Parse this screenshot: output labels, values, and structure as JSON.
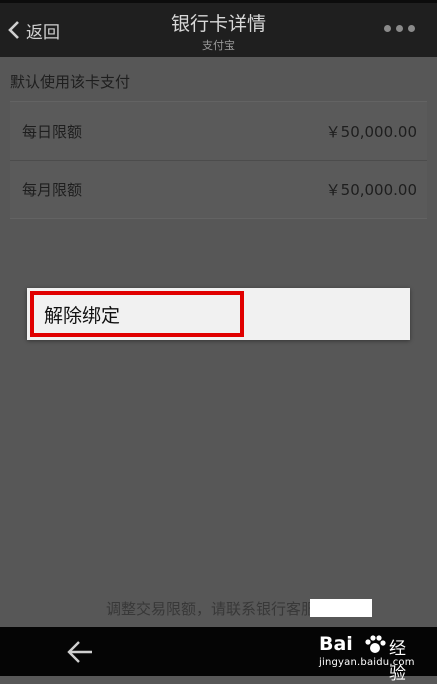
{
  "header": {
    "back_label": "返回",
    "title": "银行卡详情",
    "subtitle": "支付宝"
  },
  "content": {
    "section_title": "默认使用该卡支付",
    "limits": [
      {
        "label": "每日限额",
        "value": "￥50,000.00"
      },
      {
        "label": "每月限额",
        "value": "￥50,000.00"
      }
    ]
  },
  "context_menu": {
    "unbind_label": "解除绑定"
  },
  "footer": {
    "note": "调整交易限额，请联系银行客服："
  },
  "watermark": {
    "brand": "Bai",
    "suffix": "经验",
    "url": "jingyan.baidu.com"
  },
  "colors": {
    "highlight_border": "#e00000"
  }
}
